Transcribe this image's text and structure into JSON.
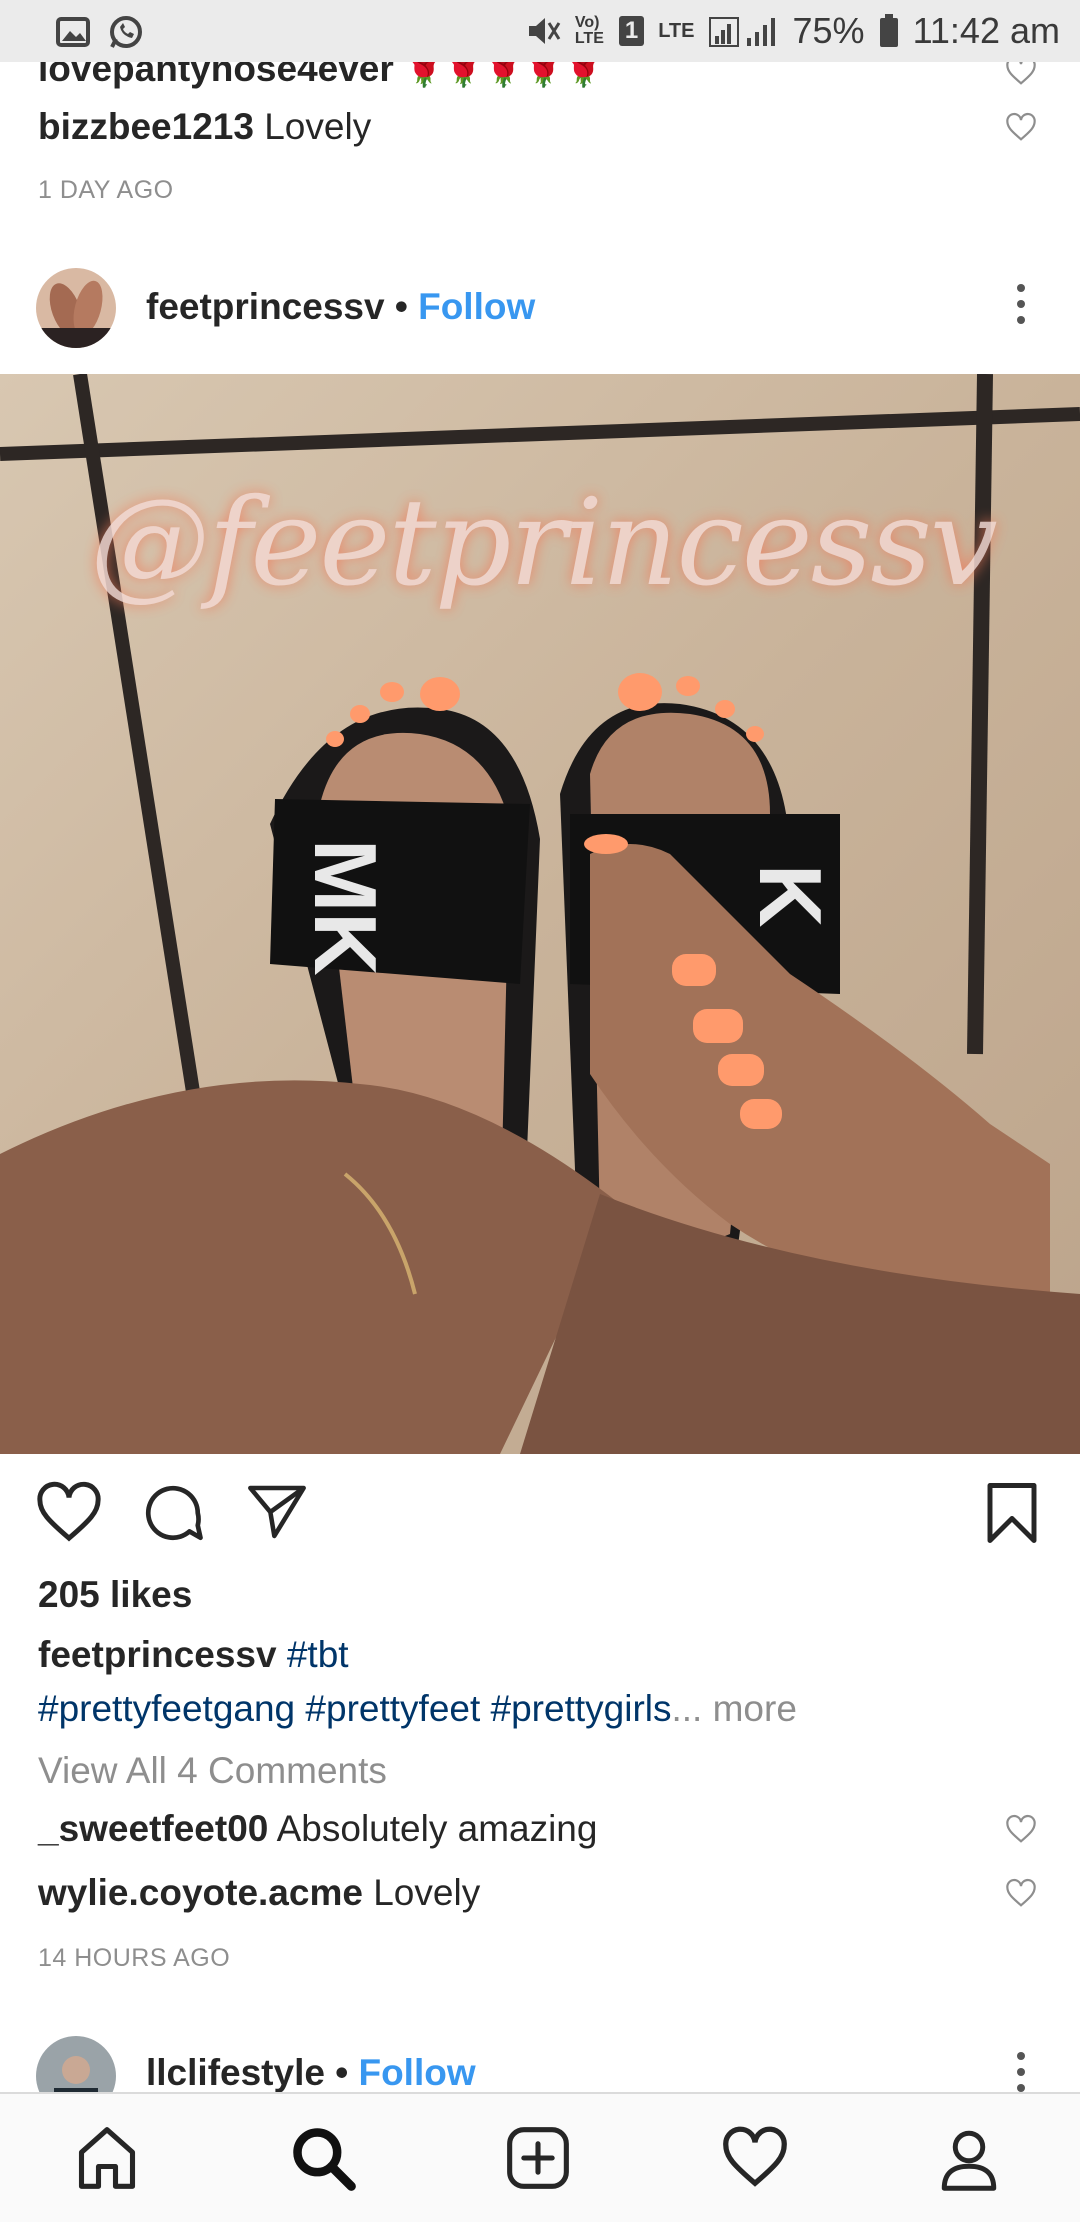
{
  "status_bar": {
    "battery": "75%",
    "time": "11:42 am",
    "sim_slot": "1",
    "network": "LTE",
    "volte": "Vo) LTE"
  },
  "prev_post": {
    "partial_user": "lovepantyhose4ever",
    "emojis": "🌹🌹🌹🌹🌹",
    "comment_user": "bizzbee1213",
    "comment_text": "Lovely",
    "time": "1 DAY AGO"
  },
  "post": {
    "username": "feetprincessv",
    "separator": "•",
    "follow_label": "Follow",
    "watermark": "@feetprincessv",
    "likes": "205 likes",
    "caption_user": "feetprincessv",
    "caption_tag1": "#tbt",
    "caption_tags": "#prettyfeetgang #prettyfeet #prettygirls",
    "ellipsis": "...",
    "more_label": "more",
    "view_all": "View All 4 Comments",
    "comments": [
      {
        "user": "_sweetfeet00",
        "text": "Absolutely amazing"
      },
      {
        "user": "wylie.coyote.acme",
        "text": "Lovely"
      }
    ],
    "time": "14 HOURS AGO"
  },
  "next_post": {
    "username": "llclifestyle",
    "separator": "•",
    "follow_label": "Follow"
  },
  "nav": [
    "home-icon",
    "search-icon",
    "add-post-icon",
    "activity-heart-icon",
    "profile-icon"
  ],
  "colors": {
    "link": "#3897f0",
    "hashtag": "#003569",
    "muted": "#8e8e8e",
    "nail": "#ff9a6c"
  }
}
